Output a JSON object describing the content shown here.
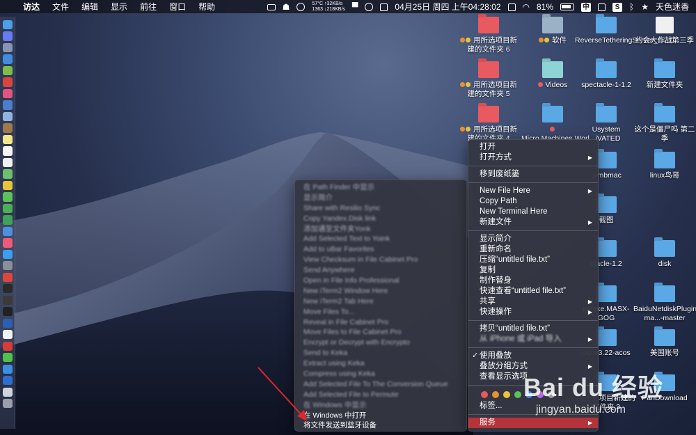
{
  "menubar": {
    "app": "访达",
    "menus": [
      "文件",
      "编辑",
      "显示",
      "前往",
      "窗口",
      "帮助"
    ],
    "netspeed_top": "57°C ↑32KB/s",
    "netspeed_bottom": "1363 ↓218KB/s",
    "datetime": "04月25日 周四 上午04:28:02",
    "battery": "81%",
    "input_method": "中",
    "user": "天色迷香"
  },
  "desktop_icons": [
    {
      "label": "用所选项目新建的文件夹 6",
      "color": "red",
      "tags": [
        "#e8912f",
        "#e8c43a"
      ]
    },
    {
      "label": "软件",
      "color": "gray",
      "tags": [
        "#e8912f",
        "#e8c43a"
      ]
    },
    {
      "label": "ReverseTetheringServer_1.2.0",
      "color": "blue",
      "tags": []
    },
    {
      "label": "约会大作战第三季",
      "color": "white",
      "tags": []
    },
    {
      "label": "用所选项目新建的文件夹 5",
      "color": "red",
      "tags": [
        "#e8912f",
        "#e8c43a"
      ]
    },
    {
      "label": "Videos",
      "color": "teal",
      "tags": [
        "#e85a5f"
      ]
    },
    {
      "label": "spectacle-1-1.2",
      "color": "blue",
      "tags": []
    },
    {
      "label": "新建文件夹",
      "color": "blue",
      "tags": []
    },
    {
      "label": "用所选项目新建的文件夹 4",
      "color": "red",
      "tags": [
        "#e8912f",
        "#e8c43a"
      ]
    },
    {
      "label": "Micro.Machines.Worl...iVATED",
      "color": "blue",
      "tags": [
        "#e85a5f"
      ]
    },
    {
      "label": "Usystem",
      "color": "blue",
      "tags": []
    },
    {
      "label": "这个是僵尸吗 第二季",
      "color": "blue",
      "tags": []
    },
    {
      "label": "grmbmac",
      "color": "blue",
      "tags": []
    },
    {
      "label": "linux鸟哥",
      "color": "blue",
      "tags": []
    },
    {
      "label": "截图",
      "color": "blue",
      "tags": []
    },
    {
      "label": "ctacle-1.2",
      "color": "blue",
      "tags": []
    },
    {
      "label": "disk",
      "color": "blue",
      "tags": []
    },
    {
      "label": "gstoke.MASX-GOG",
      "color": "blue",
      "tags": []
    },
    {
      "label": "BaiduNetdiskPlugin-ma...-master",
      "color": "blue",
      "tags": []
    },
    {
      "label": "ray-v3.22-acos",
      "color": "blue",
      "tags": []
    },
    {
      "label": "美国账号",
      "color": "blue",
      "tags": []
    },
    {
      "label": "用所选项目新建的文件夹 3",
      "color": "blue",
      "tags": []
    },
    {
      "label": "PanDownload",
      "color": "blue",
      "tags": []
    }
  ],
  "context_menu": {
    "group1": [
      "打开",
      "打开方式"
    ],
    "group2": [
      "移到废纸篓"
    ],
    "group3": [
      "New File Here",
      "Copy Path",
      "New Terminal Here",
      "新建文件"
    ],
    "group4": [
      "显示简介",
      "重新命名",
      "压缩“untitled file.txt”",
      "复制",
      "制作替身",
      "快速查看“untitled file.txt”",
      "共享",
      "快速操作"
    ],
    "group5": [
      "拷贝“untitled file.txt”",
      "从 iPhone 或 iPad 导入"
    ],
    "group6": [
      "使用叠放",
      "叠放分组方式",
      "查看显示选项"
    ],
    "tag_colors": [
      "#e85a5f",
      "#e8912f",
      "#e8c43a",
      "#5dc05a",
      "#4a8fe0",
      "#b36ae0",
      "#9a9a9a"
    ],
    "tags_label": "标签...",
    "services": "服务"
  },
  "services_submenu": {
    "items": [
      "在 Path Finder 中显示",
      "显示简介",
      "Share with Resilio Sync",
      "Copy Yandex.Disk link",
      "添加通至文件夹Yonk",
      "Add Selected Text to Yoink",
      "Add to uBar Favorites",
      "View Checksum in File Cabinet Pro",
      "Send Anywhere",
      "Open in File Info Professional",
      "New iTerm2 Window Here",
      "New iTerm2 Tab Here",
      "Move Files To...",
      "Reveal in File Cabinet Pro",
      "Move Files to File Cabinet Pro",
      "Encrypt or Decrypt with Encrypto",
      "Send to Keka",
      "Extract using Keka",
      "Compress using Keka",
      "Add Selected File To The Conversion Queue",
      "Add Selected File to Permute",
      "在 Windows 中显示",
      "在 Windows 中打开",
      "将文件发送到蓝牙设备"
    ]
  },
  "watermark": {
    "brand": "Bai du 经验",
    "url": "jingyan.baidu.com"
  }
}
